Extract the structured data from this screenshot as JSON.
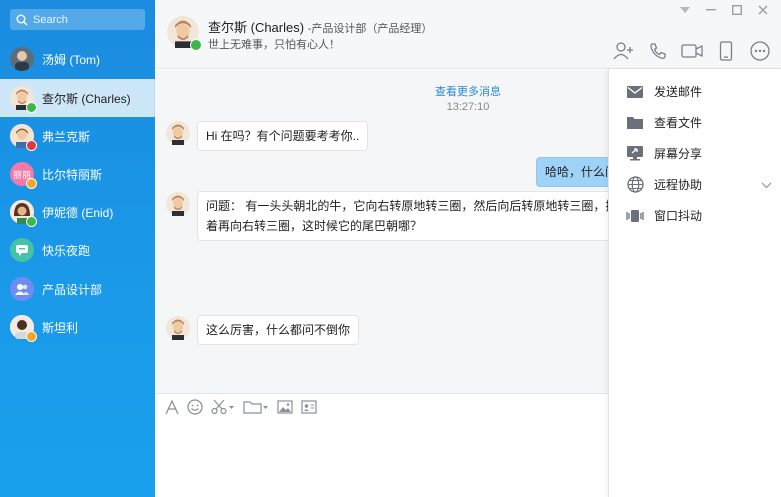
{
  "search": {
    "placeholder": "Search"
  },
  "contacts": [
    {
      "name": "汤姆 (Tom)",
      "avatar_color": "#5a6d7c",
      "status": "none"
    },
    {
      "name": "查尔斯 (Charles)",
      "avatar_color": "#e9d8c4",
      "status": "online",
      "active": true
    },
    {
      "name": "弗兰克斯",
      "avatar_color": "#d8c0a6",
      "status": "busy"
    },
    {
      "name": "比尔特丽斯",
      "avatar_color": "#f27aa8",
      "avatar_text": "丽丽",
      "status": "away"
    },
    {
      "name": "伊妮德 (Enid)",
      "avatar_color": "#8a5a3b",
      "status": "online"
    },
    {
      "name": "快乐夜跑",
      "avatar_color": "#45c3a6",
      "status": "none"
    },
    {
      "name": "产品设计部",
      "avatar_color": "#6d8ef0",
      "status": "none"
    },
    {
      "name": "斯坦利",
      "avatar_color": "#3b2b25",
      "status": "away"
    }
  ],
  "header": {
    "name": "查尔斯 (Charles)",
    "role": "-产品设计部（产品经理）",
    "signature": "世上无难事，只怕有心人！"
  },
  "chat": {
    "more_link": "查看更多消息",
    "timestamp": "13:27:10",
    "messages": [
      {
        "from": "other",
        "text": "Hi  在吗？有个问题要考考你.."
      },
      {
        "from": "me",
        "text": "哈哈，什么问"
      },
      {
        "from": "other",
        "text": "问题：  有一头头朝北的牛，它向右转原地转三圈，然后向后转原地转三圈，接着再向右转三圈，这时候它的尾巴朝哪？"
      },
      {
        "from": "other",
        "text": "这么厉害，什么都问不倒你"
      }
    ]
  },
  "menu": {
    "items": [
      {
        "label": "发送邮件",
        "icon": "mail-icon"
      },
      {
        "label": "查看文件",
        "icon": "folder-icon"
      },
      {
        "label": "屏幕分享",
        "icon": "screen-share-icon"
      },
      {
        "label": "远程协助",
        "icon": "globe-icon",
        "has_submenu": true
      },
      {
        "label": "窗口抖动",
        "icon": "shake-icon"
      }
    ]
  },
  "colors": {
    "sidebar": "#1a9ae8",
    "active_contact": "#cde6f8",
    "my_bubble": "#9ed2f6",
    "link": "#2b88d9"
  }
}
